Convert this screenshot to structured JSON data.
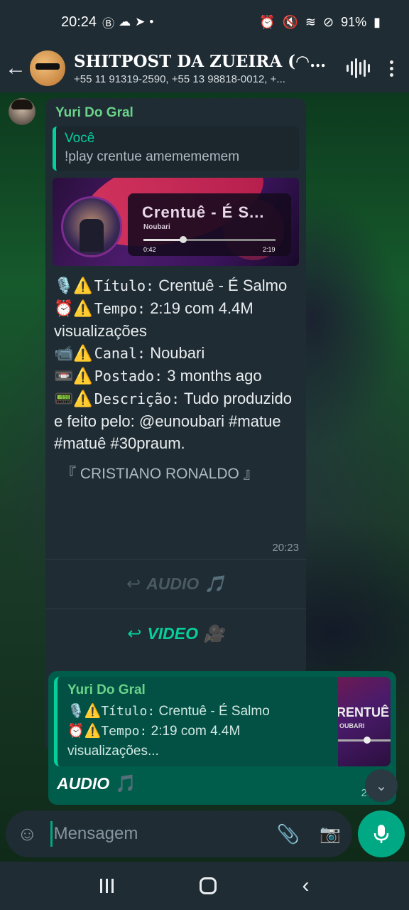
{
  "status_bar": {
    "time": "20:24",
    "battery": "91%"
  },
  "header": {
    "title": "SHITPOST DA ZUEIRA (◠‿...",
    "subtitle": "+55 11 91319-2590, +55 13 98818-0012, +..."
  },
  "message_in": {
    "author": "Yuri Do Gral",
    "quote_name": "Você",
    "quote_text": "!play crentue amemememem",
    "thumbnail": {
      "title": "Crentuê - É S...",
      "artist": "Noubari",
      "elapsed": "0:42",
      "duration": "2:19",
      "progress": 0.3
    },
    "lines": [
      {
        "emoji": "🎙️⚠️",
        "key": "Título",
        "value": "Crentuê - É Salmo"
      },
      {
        "emoji": "⏰⚠️",
        "key": "Tempo",
        "value": "2:19 com 4.4M visualizações"
      },
      {
        "emoji": "📹⚠️",
        "key": "Canal",
        "value": "Noubari"
      },
      {
        "emoji": "📼⚠️",
        "key": "Postado",
        "value": "3 months ago"
      },
      {
        "emoji": "📟⚠️",
        "key": "Descrição",
        "value": "Tudo produzido e feito pelo: @eunoubari #matue #matuê #30praum."
      }
    ],
    "footer": "『 CRISTIANO RONALDO 』",
    "time": "20:23",
    "button_audio": "AUDIO",
    "button_audio_icon": "🎵",
    "button_video": "VIDEO",
    "button_video_icon": "🎥"
  },
  "message_out": {
    "quote_author": "Yuri Do Gral",
    "quote_line1_emoji": "🎙️⚠️",
    "quote_line1_key": "Título",
    "quote_line1_value": "Crentuê - É Salmo",
    "quote_line2_emoji": "⏰⚠️",
    "quote_line2_key": "Tempo",
    "quote_line2_value": "2:19 com 4.4M",
    "quote_line3": "visualizações...",
    "thumb_title": "RENTUÊ",
    "thumb_artist": "OUBARI",
    "body": "AUDIO",
    "body_icon": "🎵",
    "time": "20:23"
  },
  "input": {
    "placeholder": "Mensagem"
  },
  "icons": {
    "back": "arrow-left-icon",
    "voice_call": "audio-waves-icon",
    "menu": "kebab-menu-icon",
    "emoji": "emoji-icon",
    "attach": "paperclip-icon",
    "camera": "camera-icon",
    "mic": "microphone-icon"
  }
}
